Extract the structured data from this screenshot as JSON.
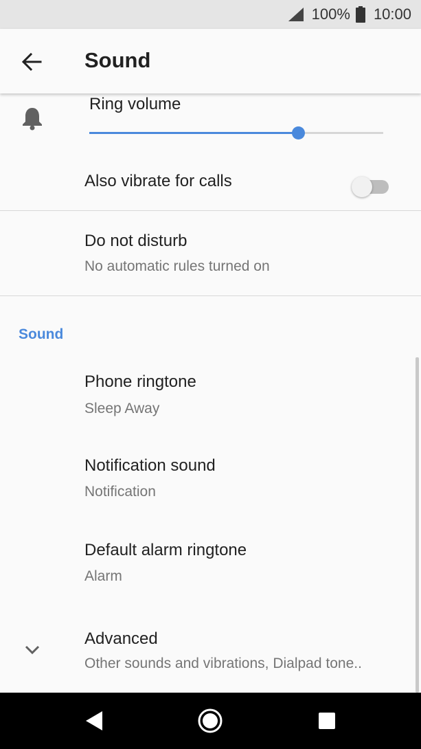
{
  "status_bar": {
    "battery_percent": "100%",
    "time": "10:00",
    "signal_icon": "cell-signal-icon",
    "battery_icon": "battery-full-icon"
  },
  "toolbar": {
    "title": "Sound",
    "back_icon": "arrow-left-icon"
  },
  "volume": {
    "label": "Ring volume",
    "level_fraction": 0.71,
    "icon": "bell-icon"
  },
  "vibrate": {
    "label": "Also vibrate for calls",
    "enabled": false
  },
  "dnd": {
    "title": "Do not disturb",
    "subtitle": "No automatic rules turned on"
  },
  "section": {
    "header": "Sound"
  },
  "items": [
    {
      "title": "Phone ringtone",
      "subtitle": "Sleep Away"
    },
    {
      "title": "Notification sound",
      "subtitle": "Notification"
    },
    {
      "title": "Default alarm ringtone",
      "subtitle": "Alarm"
    },
    {
      "title": "Advanced",
      "subtitle": "Other sounds and vibrations, Dialpad tone.."
    }
  ],
  "navbar": {
    "back_icon": "nav-back-icon",
    "home_icon": "nav-home-icon",
    "recents_icon": "nav-recents-icon"
  },
  "colors": {
    "accent": "#4a89dc",
    "background": "#fafafa",
    "status_bar": "#e5e5e5",
    "nav_bar": "#000000"
  }
}
